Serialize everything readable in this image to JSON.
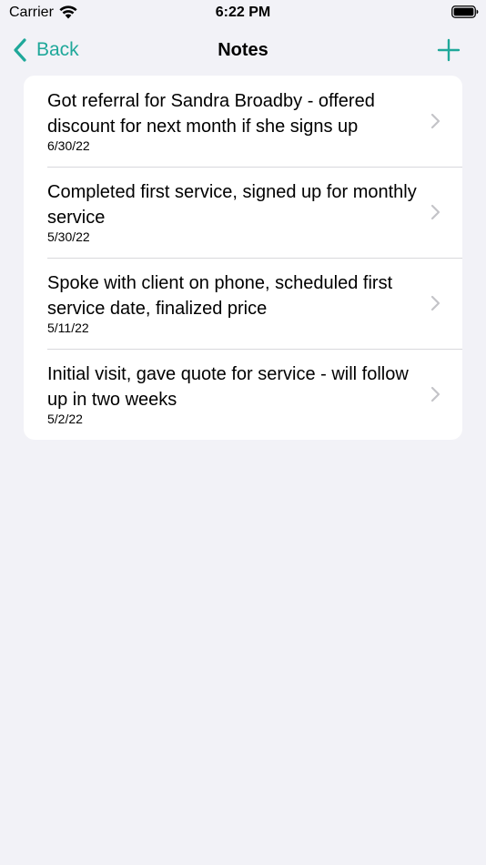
{
  "status_bar": {
    "carrier": "Carrier",
    "time": "6:22 PM",
    "wifi_icon": "wifi-icon",
    "battery_icon": "battery-icon"
  },
  "nav": {
    "back_label": "Back",
    "title": "Notes",
    "add_icon": "plus-icon",
    "accent_color": "#1fa89a"
  },
  "notes": [
    {
      "text": "Got referral for Sandra Broadby - offered discount for next month if she signs up",
      "date": "6/30/22"
    },
    {
      "text": "Completed first service, signed up for monthly service",
      "date": "5/30/22"
    },
    {
      "text": "Spoke with client on phone, scheduled first service date, finalized price",
      "date": "5/11/22"
    },
    {
      "text": "Initial visit, gave quote for service - will follow up in two weeks",
      "date": "5/2/22"
    }
  ]
}
